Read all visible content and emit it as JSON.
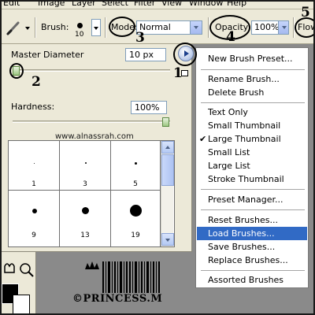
{
  "menubar": {
    "items": [
      "Edit",
      "Image",
      "Layer",
      "Select",
      "Filter",
      "View",
      "Window",
      "Help"
    ]
  },
  "options_bar": {
    "brush_label": "Brush:",
    "brush_size": "10",
    "mode_label": "Mode:",
    "mode_value": "Normal",
    "opacity_label": "Opacity:",
    "opacity_value": "100%",
    "flow_label": "Flow"
  },
  "brush_panel": {
    "master_diameter_label": "Master Diameter",
    "master_diameter_value": "10 px",
    "hardness_label": "Hardness:",
    "hardness_value": "100%",
    "watermark": "www.alnassrah.com",
    "presets": [
      {
        "size": "1"
      },
      {
        "size": "3"
      },
      {
        "size": "5"
      },
      {
        "size": "9"
      },
      {
        "size": "13"
      },
      {
        "size": "19"
      }
    ]
  },
  "annotations": [
    "1",
    "2",
    "3",
    "4",
    "5"
  ],
  "menu": {
    "groups": [
      [
        "New Brush Preset..."
      ],
      [
        "Rename Brush...",
        "Delete Brush"
      ],
      [
        "Text Only",
        "Small Thumbnail",
        "Large Thumbnail",
        "Small List",
        "Large List",
        "Stroke Thumbnail"
      ],
      [
        "Preset Manager..."
      ],
      [
        "Reset Brushes...",
        "Load Brushes...",
        "Save Brushes...",
        "Replace Brushes..."
      ],
      [
        "Assorted Brushes"
      ]
    ],
    "checked": "Large Thumbnail",
    "highlighted": "Load Brushes..."
  },
  "credit": "©PRINCESS.M",
  "colors": {
    "highlight": "#316ac5",
    "panel_bg": "#ece9d8",
    "workspace": "#8a8a8a"
  }
}
